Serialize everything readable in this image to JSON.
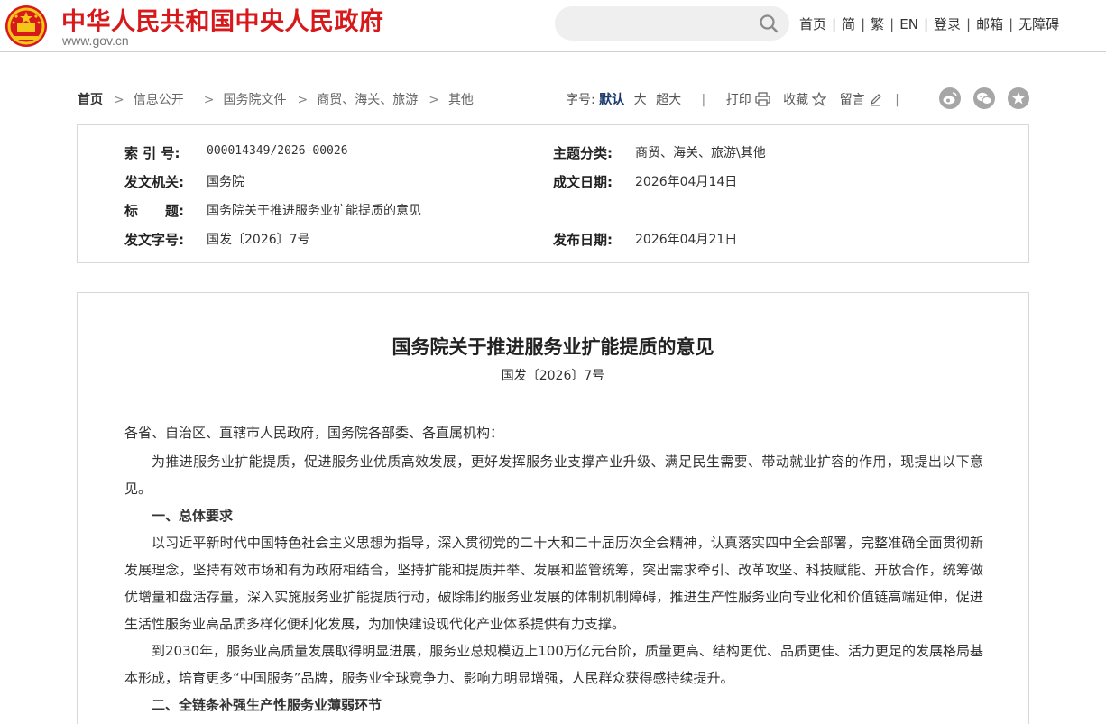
{
  "header": {
    "site_title": "中华人民共和国中央人民政府",
    "site_url": "www.gov.cn",
    "search_placeholder": "",
    "nav": [
      "首页",
      "简",
      "繁",
      "EN",
      "登录",
      "邮箱",
      "无障碍"
    ]
  },
  "breadcrumb": [
    "首页",
    "信息公开",
    "国务院文件",
    "商贸、海关、旅游",
    "其他"
  ],
  "toolbar": {
    "font_size_label": "字号:",
    "font_sizes": [
      "默认",
      "大",
      "超大"
    ],
    "print": "打印",
    "favorite": "收藏",
    "comment": "留言"
  },
  "colors": {
    "brand_red": "#d7191c",
    "link_blue": "#1a3a6b",
    "share_gray": "#a6a6a6"
  },
  "info": {
    "index_label": "索 引 号:",
    "index_value": "000014349/2026-00026",
    "issuer_label": "发文机关:",
    "issuer_value": "国务院",
    "title_label": "标　　题:",
    "title_value": "国务院关于推进服务业扩能提质的意见",
    "docnum_label": "发文字号:",
    "docnum_value": "国发〔2026〕7号",
    "topic_label": "主题分类:",
    "topic_value": "商贸、海关、旅游\\其他",
    "written_label": "成文日期:",
    "written_value": "2026年04月14日",
    "published_label": "发布日期:",
    "published_value": "2026年04月21日"
  },
  "article": {
    "title": "国务院关于推进服务业扩能提质的意见",
    "docnum": "国发〔2026〕7号",
    "salutation": "各省、自治区、直辖市人民政府，国务院各部委、各直属机构：",
    "intro": "为推进服务业扩能提质，促进服务业优质高效发展，更好发挥服务业支撑产业升级、满足民生需要、带动就业扩容的作用，现提出以下意见。",
    "heading1": "一、总体要求",
    "para1": "以习近平新时代中国特色社会主义思想为指导，深入贯彻党的二十大和二十届历次全会精神，认真落实四中全会部署，完整准确全面贯彻新发展理念，坚持有效市场和有为政府相结合，坚持扩能和提质并举、发展和监管统筹，突出需求牵引、改革攻坚、科技赋能、开放合作，统筹做优增量和盘活存量，深入实施服务业扩能提质行动，破除制约服务业发展的体制机制障碍，推进生产性服务业向专业化和价值链高端延伸，促进生活性服务业高品质多样化便利化发展，为加快建设现代化产业体系提供有力支撑。",
    "para2": "到2030年，服务业高质量发展取得明显进展，服务业总规模迈上100万亿元台阶，质量更高、结构更优、品质更佳、活力更足的发展格局基本形成，培育更多“中国服务”品牌，服务业全球竞争力、影响力明显增强，人民群众获得感持续提升。",
    "heading2": "二、全链条补强生产性服务业薄弱环节"
  }
}
